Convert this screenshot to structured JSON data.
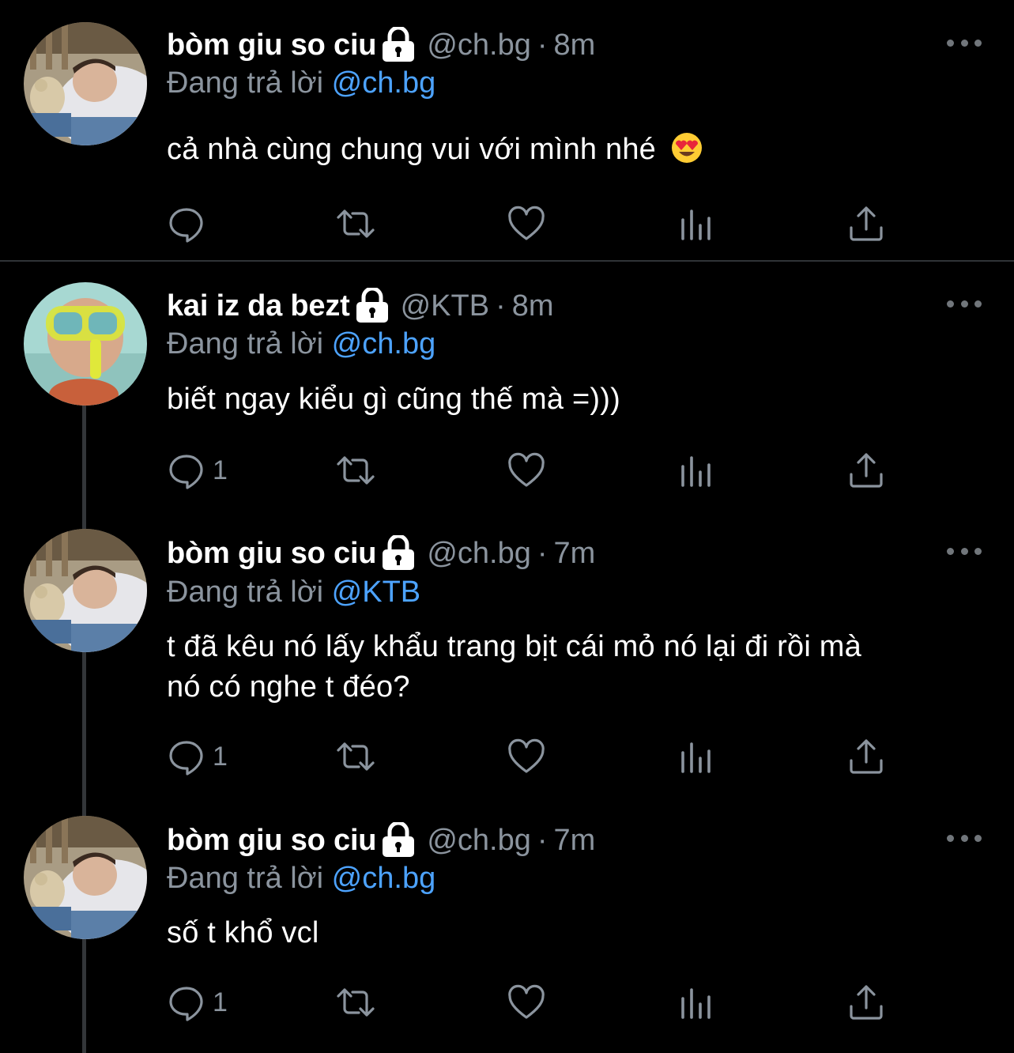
{
  "tweets": [
    {
      "display_name": "bòm giu so ciu",
      "handle": "@ch.bg",
      "time": "8m",
      "replying_label": "Đang trả lời",
      "replying_to": "@ch.bg",
      "text": "cả nhà cùng chung vui với mình nhé",
      "emoji": "smiling-face-with-heart-eyes",
      "reply_count": ""
    },
    {
      "display_name": "kai iz da bezt",
      "handle": "@KTB",
      "time": "8m",
      "replying_label": "Đang trả lời",
      "replying_to": "@ch.bg",
      "text": "biết ngay kiểu gì cũng thế mà =)))",
      "reply_count": "1"
    },
    {
      "display_name": "bòm giu so ciu",
      "handle": "@ch.bg",
      "time": "7m",
      "replying_label": "Đang trả lời",
      "replying_to": "@KTB",
      "text_line1": "t đã kêu nó lấy khẩu trang bịt cái mỏ nó lại đi rồi mà",
      "text_line2": "nó có nghe t đéo?",
      "reply_count": "1"
    },
    {
      "display_name": "bòm giu so ciu",
      "handle": "@ch.bg",
      "time": "7m",
      "replying_label": "Đang trả lời",
      "replying_to": "@ch.bg",
      "text": "số t khổ vcl",
      "reply_count": "1"
    }
  ],
  "separator": "·",
  "icons": {
    "reply": "reply-icon",
    "retweet": "retweet-icon",
    "like": "heart-icon",
    "views": "analytics-icon",
    "share": "share-icon",
    "more": "more-icon",
    "lock": "lock-icon"
  },
  "colors": {
    "background": "#000000",
    "text": "#ffffff",
    "secondary": "#8b949e",
    "mention": "#4da3ff",
    "thread_line": "#333639"
  }
}
